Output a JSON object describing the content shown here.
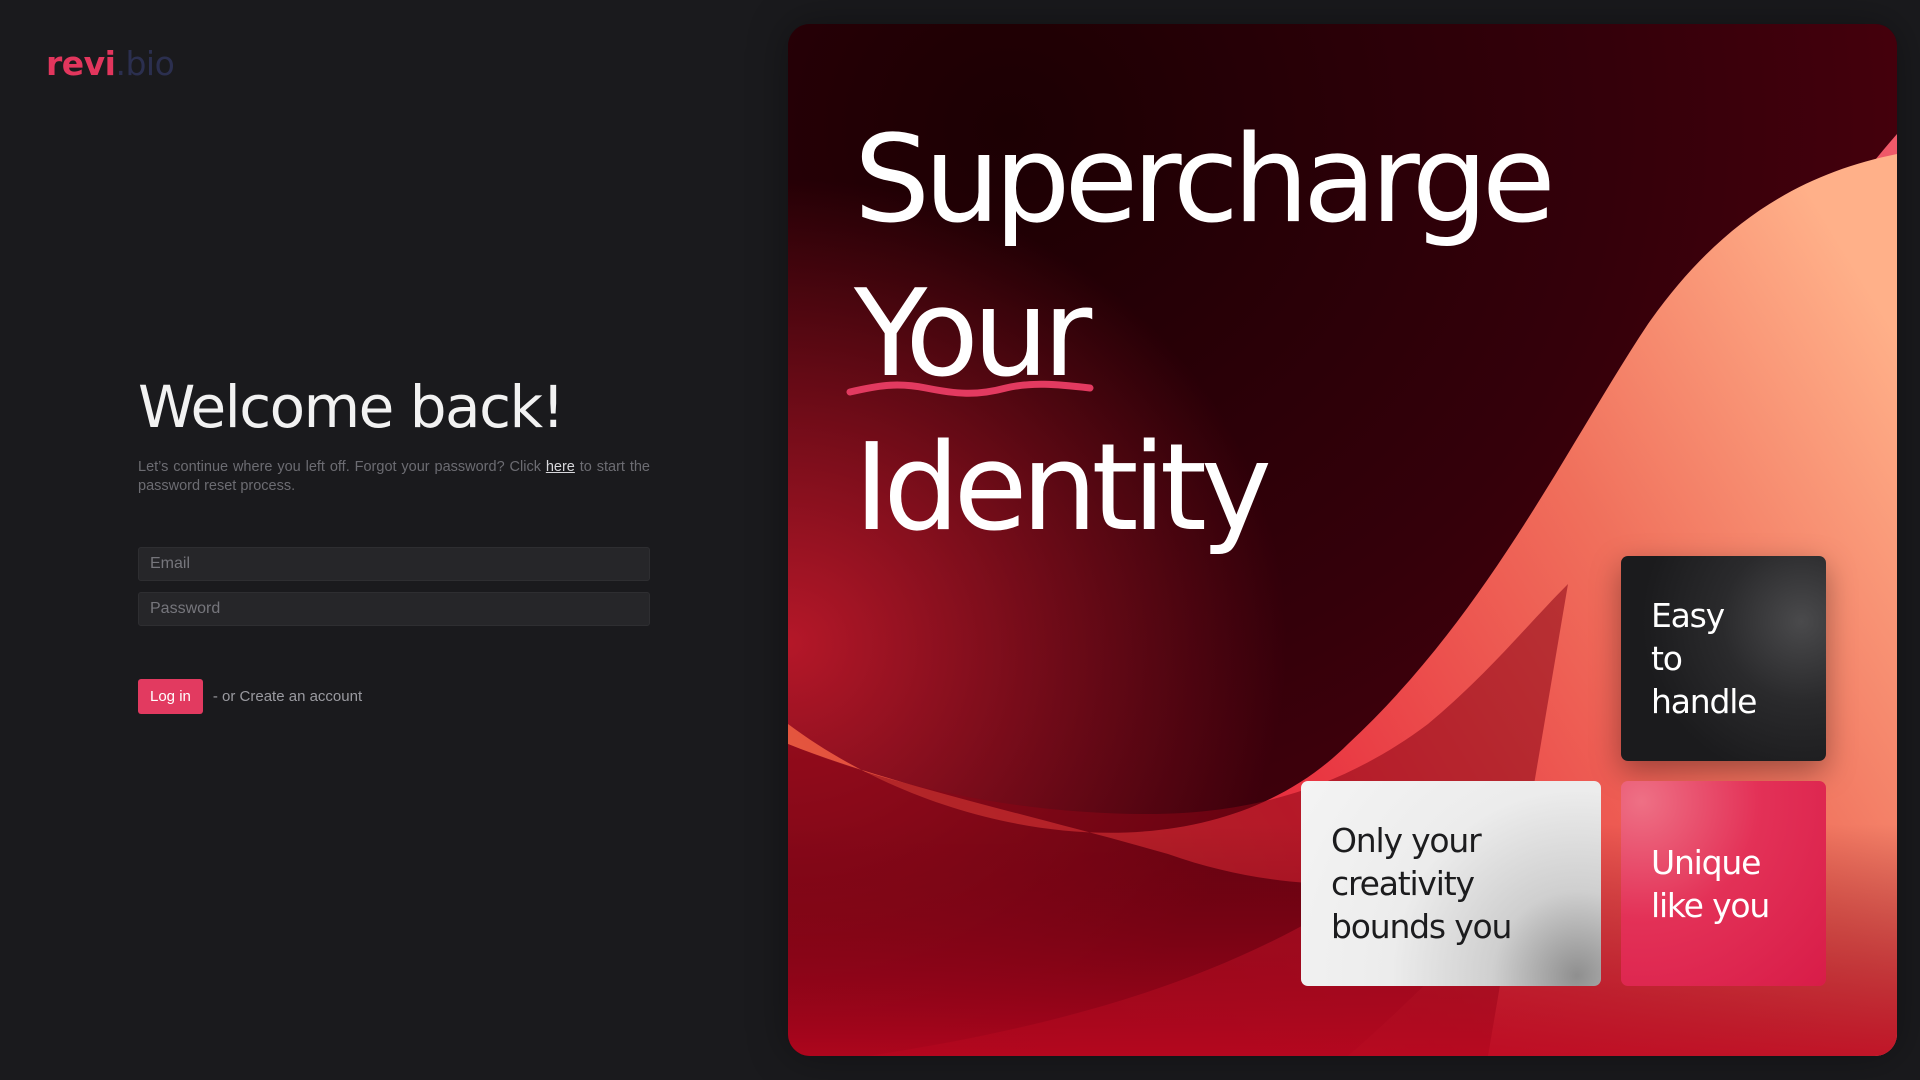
{
  "brand": {
    "logo_part1": "revi",
    "logo_part2": ".bio",
    "accent_color": "#e2365d"
  },
  "login": {
    "title": "Welcome back!",
    "subtitle_before": "Let’s continue where you left off. Forgot your password? Click ",
    "subtitle_link": "here",
    "subtitle_after": " to start the password reset process.",
    "email_placeholder": "Email",
    "password_placeholder": "Password",
    "login_button": "Log in",
    "create_account_text": "- or Create an account"
  },
  "hero": {
    "headline_line1": "Supercharge",
    "headline_line2": "Your",
    "headline_line3": "Identity",
    "tiles": {
      "easy": "Easy\nto handle",
      "creativity": "Only your\ncreativity\nbounds you",
      "unique": "Unique\nlike you"
    },
    "colors": {
      "background_dark": "#2a0007",
      "wave_red": "#e0243f",
      "wave_coral": "#f4826a",
      "squiggle": "#e23a60"
    }
  }
}
